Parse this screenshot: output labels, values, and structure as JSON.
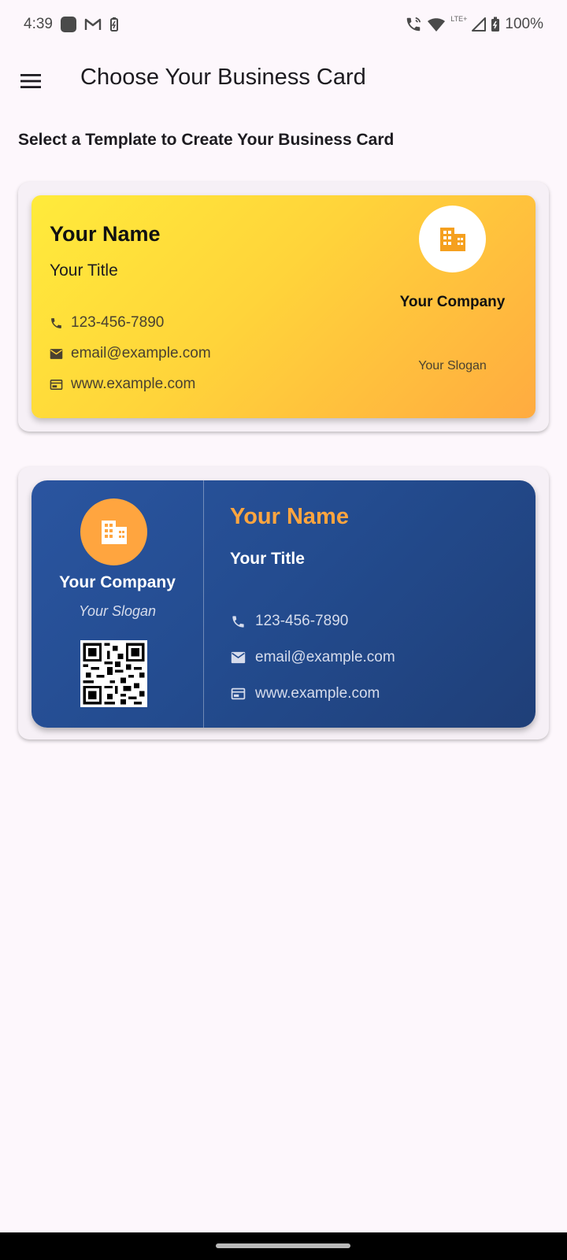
{
  "status_bar": {
    "time": "4:39",
    "battery": "100%",
    "network_type": "LTE+",
    "icons_left": [
      "app-notification-icon",
      "gmail-icon",
      "battery-saver-icon"
    ],
    "icons_right": [
      "wifi-calling-icon",
      "wifi-icon",
      "signal-icon",
      "battery-icon"
    ]
  },
  "app_bar": {
    "title": "Choose Your Business Card",
    "menu_icon": "menu-icon"
  },
  "subtitle": "Select a Template to Create Your Business Card",
  "templates": [
    {
      "name": "Your Name",
      "title": "Your Title",
      "phone": "123-456-7890",
      "email": "email@example.com",
      "website": "www.example.com",
      "company": "Your Company",
      "slogan": "Your Slogan",
      "logo_icon": "building-icon",
      "colors": {
        "gradient_start": "#ffeb3b",
        "gradient_end": "#ffab40",
        "logo_bg": "#ffffff",
        "logo_icon": "#f5a623"
      }
    },
    {
      "name": "Your Name",
      "title": "Your Title",
      "phone": "123-456-7890",
      "email": "email@example.com",
      "website": "www.example.com",
      "company": "Your Company",
      "slogan": "Your Slogan",
      "logo_icon": "building-icon",
      "qr_icon": "qr-code-icon",
      "colors": {
        "background": "#234b8e",
        "accent": "#ffa53f",
        "text": "#ffffff"
      }
    }
  ]
}
